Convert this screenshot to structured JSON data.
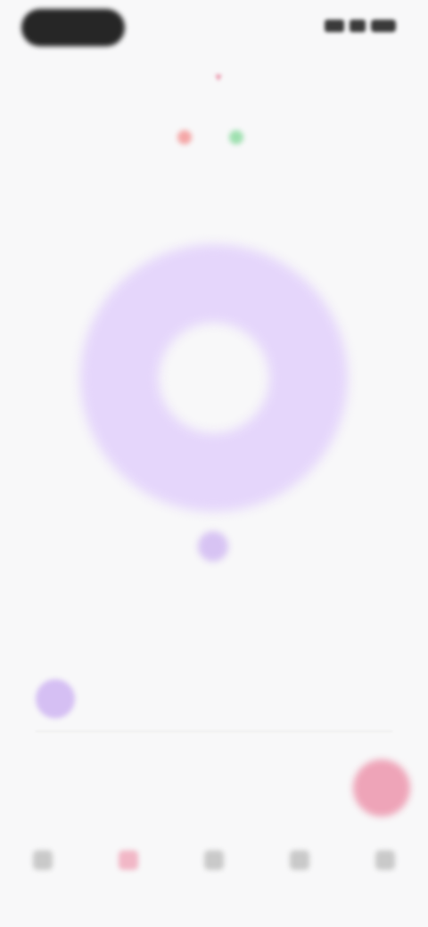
{
  "status_bar": {
    "left_pill": "",
    "signal_icon": "signal-icon",
    "wifi_icon": "wifi-icon",
    "battery_icon": "battery-icon"
  },
  "header": {
    "month_label": "",
    "chevron": "▾"
  },
  "tabs": [
    {
      "label": "",
      "color": "#f4a7a7"
    },
    {
      "label": "",
      "color": "#9fe0b0"
    }
  ],
  "chart_data": {
    "type": "pie",
    "categories": [
      ""
    ],
    "values": [
      100
    ],
    "colors": [
      "#e5d6fb"
    ],
    "hole_color": "#f8f8f9"
  },
  "pointer": {
    "label": ""
  },
  "summary": {
    "label": "",
    "amount": ""
  },
  "categories_list": [
    {
      "name": "",
      "amount": "",
      "color": "#d5bff3"
    }
  ],
  "fab": {
    "icon": "plus-icon",
    "symbol": "",
    "color": "#eea4b8"
  },
  "bottom_nav": [
    {
      "label": "",
      "icon": "home-icon",
      "active": false
    },
    {
      "label": "",
      "icon": "chart-icon",
      "active": true
    },
    {
      "label": "",
      "icon": "wallet-icon",
      "active": false
    },
    {
      "label": "",
      "icon": "calendar-icon",
      "active": false
    },
    {
      "label": "",
      "icon": "settings-icon",
      "active": false
    }
  ]
}
